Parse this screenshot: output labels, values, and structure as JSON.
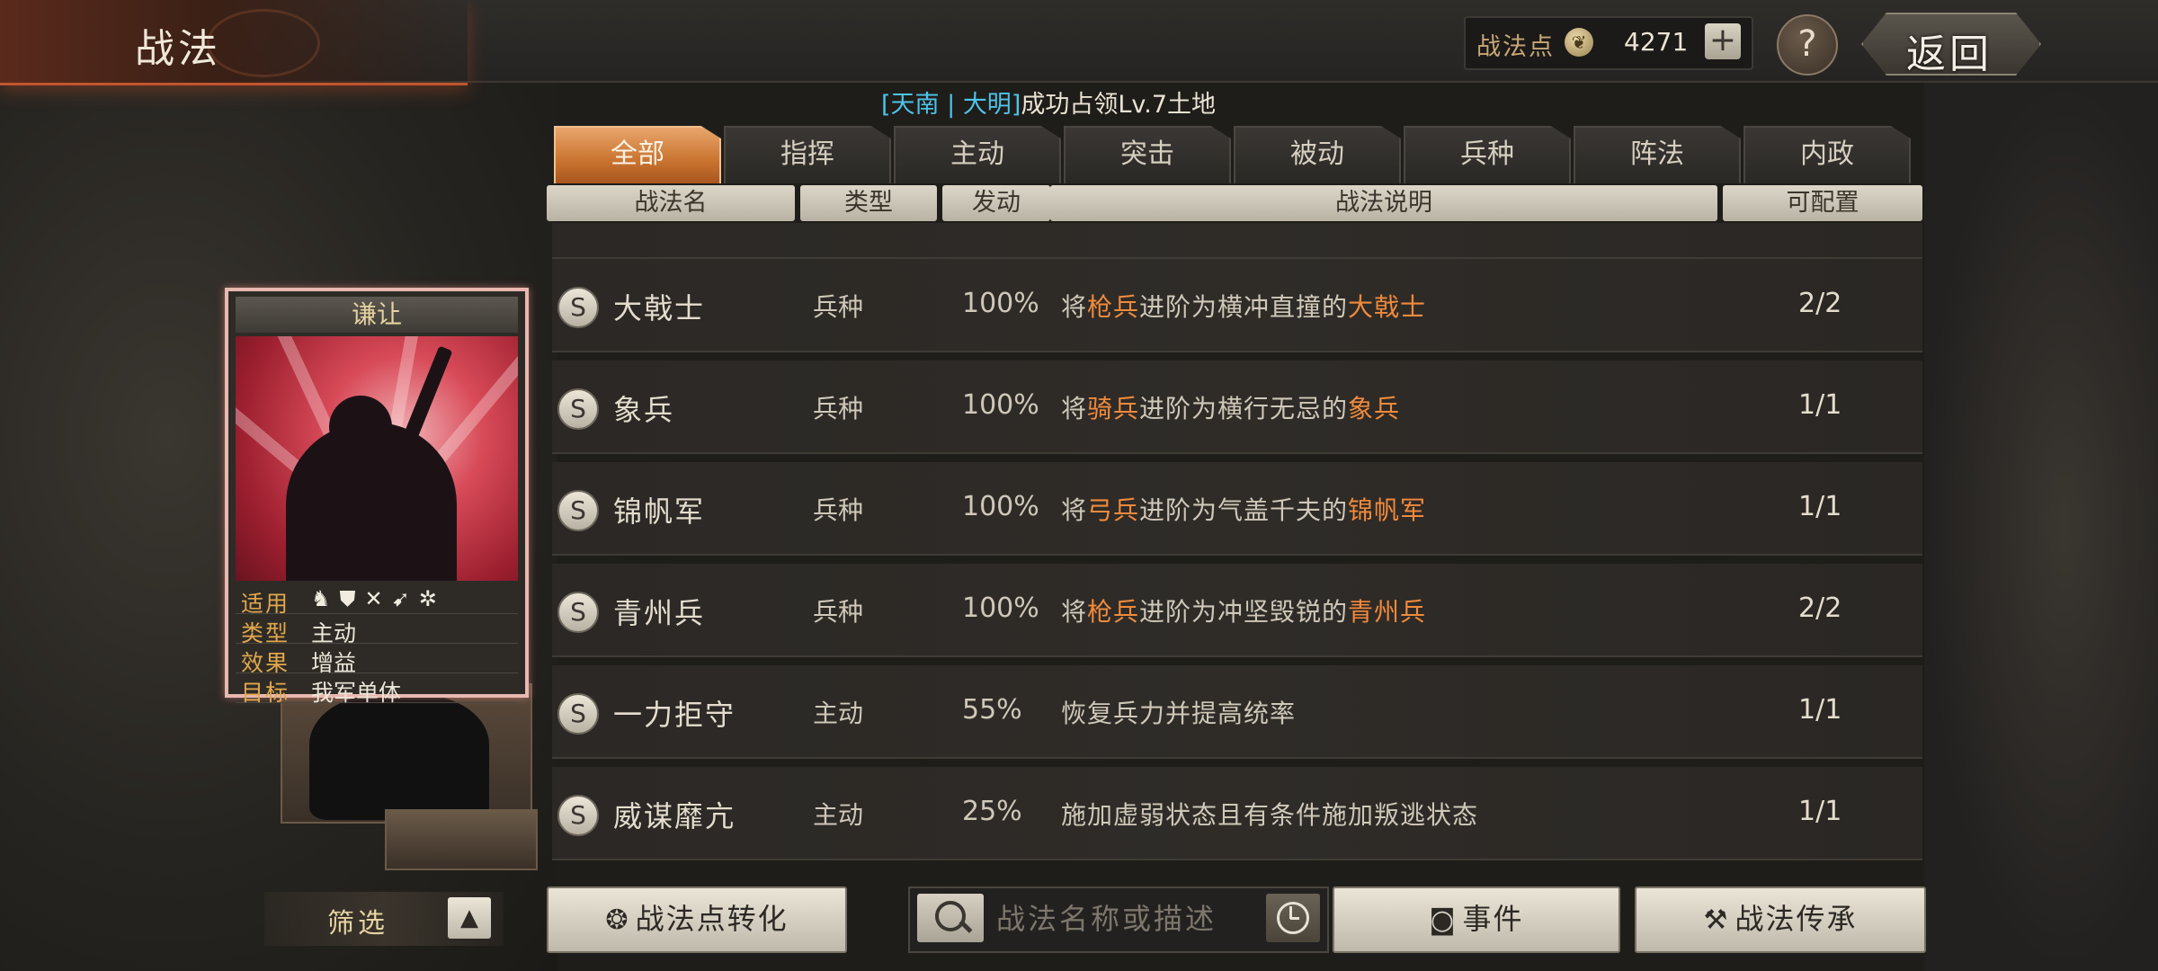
{
  "header": {
    "title": "战法",
    "points_label": "战法点",
    "points_value": "4271",
    "plus_label": "+",
    "help_label": "?",
    "back_label": "返回"
  },
  "notice": {
    "bracket_open": "[",
    "place": "天南",
    "sep": " | ",
    "nation": "大明",
    "bracket_close": "]",
    "message": "成功占领Lv.7土地"
  },
  "tabs": [
    "全部",
    "指挥",
    "主动",
    "突击",
    "被动",
    "兵种",
    "阵法",
    "内政"
  ],
  "active_tab": 0,
  "columns": {
    "name": "战法名",
    "type": "类型",
    "rate": "发动",
    "desc": "战法说明",
    "count": "可配置"
  },
  "rows": [
    {
      "grade": "S",
      "name": "大戟士",
      "type": "兵种",
      "rate": "100%",
      "desc": [
        {
          "t": "将"
        },
        {
          "t": "枪兵",
          "hl": true
        },
        {
          "t": "进阶为横冲直撞的"
        },
        {
          "t": "大戟士",
          "hl": true
        }
      ],
      "count": "2/2"
    },
    {
      "grade": "S",
      "name": "象兵",
      "type": "兵种",
      "rate": "100%",
      "desc": [
        {
          "t": "将"
        },
        {
          "t": "骑兵",
          "hl": true
        },
        {
          "t": "进阶为横行无忌的"
        },
        {
          "t": "象兵",
          "hl": true
        }
      ],
      "count": "1/1"
    },
    {
      "grade": "S",
      "name": "锦帆军",
      "type": "兵种",
      "rate": "100%",
      "desc": [
        {
          "t": "将"
        },
        {
          "t": "弓兵",
          "hl": true
        },
        {
          "t": "进阶为气盖千夫的"
        },
        {
          "t": "锦帆军",
          "hl": true
        }
      ],
      "count": "1/1"
    },
    {
      "grade": "S",
      "name": "青州兵",
      "type": "兵种",
      "rate": "100%",
      "desc": [
        {
          "t": "将"
        },
        {
          "t": "枪兵",
          "hl": true
        },
        {
          "t": "进阶为冲坚毁锐的"
        },
        {
          "t": "青州兵",
          "hl": true
        }
      ],
      "count": "2/2"
    },
    {
      "grade": "S",
      "name": "一力拒守",
      "type": "主动",
      "rate": "55%",
      "desc": [
        {
          "t": "恢复兵力并提高统率"
        }
      ],
      "count": "1/1"
    },
    {
      "grade": "S",
      "name": "威谋靡亢",
      "type": "主动",
      "rate": "25%",
      "desc": [
        {
          "t": "施加虚弱状态且有条件施加叛逃状态"
        }
      ],
      "count": "1/1"
    }
  ],
  "card": {
    "name": "谦让",
    "apply_label": "适用",
    "apply_icons": "♞⛊✕➹✲",
    "type_label": "类型",
    "type_value": "主动",
    "effect_label": "效果",
    "effect_value": "增益",
    "target_label": "目标",
    "target_value": "我军单体"
  },
  "bottom": {
    "filter_label": "筛选",
    "filter_toggle": "▲",
    "convert_label": "战法点转化",
    "search_placeholder": "战法名称或描述",
    "event_label": "事件",
    "inherit_label": "战法传承"
  },
  "colors": {
    "accent_orange": "#f08a3c",
    "notice_blue": "#4ec3e8",
    "active_tab": "#d9843f",
    "card_border": "#e8b8b0"
  }
}
